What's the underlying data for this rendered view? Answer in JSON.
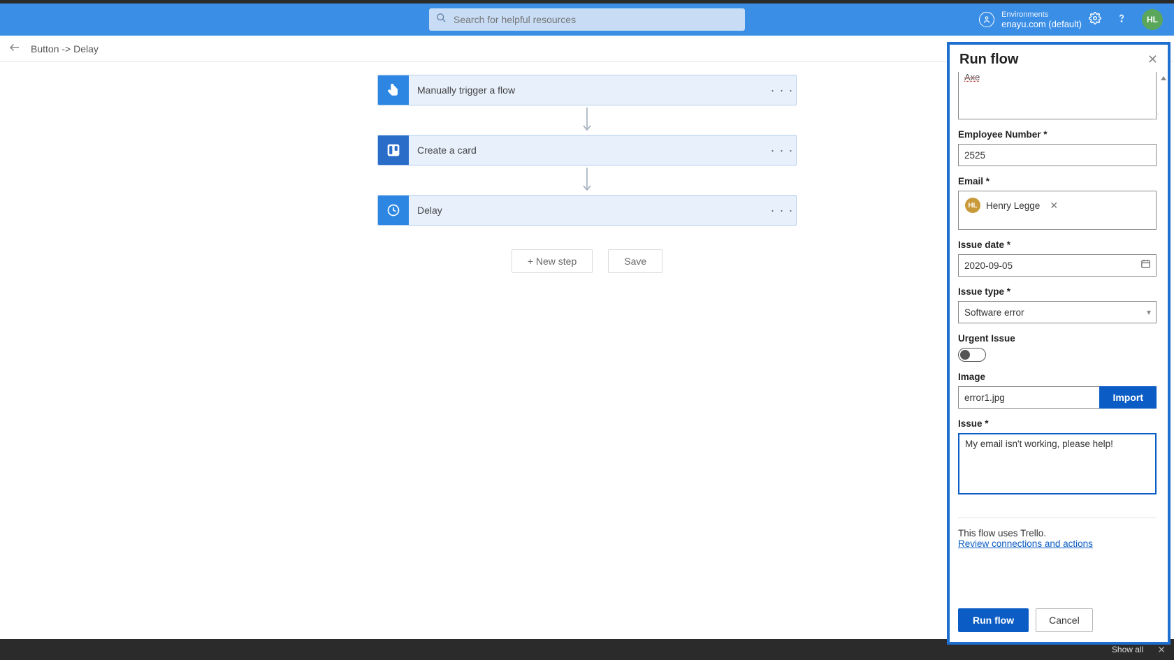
{
  "header": {
    "search_placeholder": "Search for helpful resources",
    "environments_label": "Environments",
    "environment_name": "enayu.com (default)",
    "avatar_initials": "HL"
  },
  "breadcrumb": {
    "text": "Button -> Delay"
  },
  "flow": {
    "steps": [
      {
        "label": "Manually trigger a flow",
        "icon": "hand-tap",
        "bg": "bg-blue1"
      },
      {
        "label": "Create a card",
        "icon": "trello",
        "bg": "bg-trello"
      },
      {
        "label": "Delay",
        "icon": "clock",
        "bg": "bg-blue1"
      }
    ],
    "new_step_label": "+ New step",
    "save_label": "Save"
  },
  "panel": {
    "title": "Run flow",
    "partial_field_value": "Axe",
    "employee_number_label": "Employee Number *",
    "employee_number_value": "2525",
    "email_label": "Email *",
    "email_chip_name": "Henry Legge",
    "email_chip_initials": "HL",
    "issue_date_label": "Issue date *",
    "issue_date_value": "2020-09-05",
    "issue_type_label": "Issue type *",
    "issue_type_value": "Software error",
    "urgent_label": "Urgent Issue",
    "image_label": "Image",
    "image_value": "error1.jpg",
    "import_label": "Import",
    "issue_label": "Issue *",
    "issue_value": "My email isn't working, please help!",
    "uses_text": "This flow uses Trello.",
    "review_link": "Review connections and actions",
    "run_label": "Run flow",
    "cancel_label": "Cancel"
  },
  "bottom": {
    "show_all": "Show all"
  }
}
